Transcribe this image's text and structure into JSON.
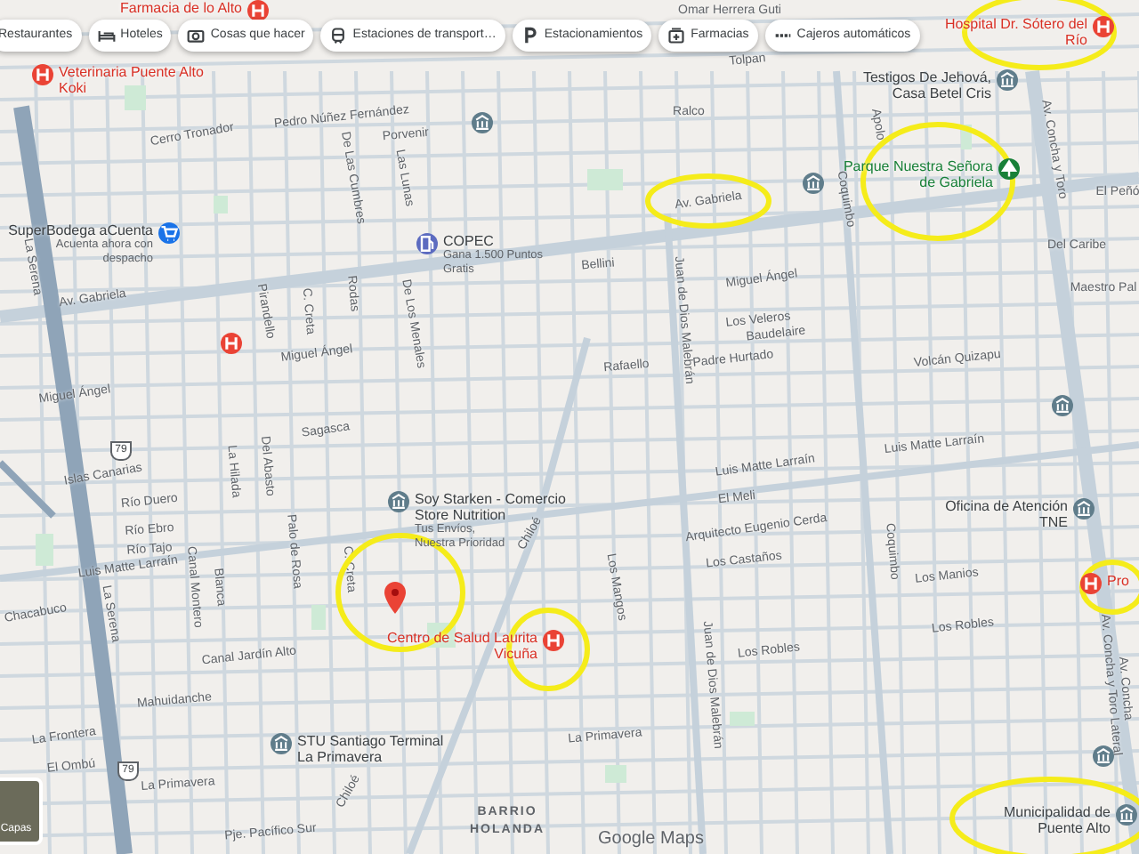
{
  "chips": [
    {
      "label": "Restaurantes"
    },
    {
      "label": "Hoteles"
    },
    {
      "label": "Cosas que hacer"
    },
    {
      "label": "Estaciones de transport…"
    },
    {
      "label": "Estacionamientos"
    },
    {
      "label": "Farmacias"
    },
    {
      "label": "Cajeros automáticos"
    }
  ],
  "pois": [
    {
      "name": "Farmacia de lo Alto",
      "kind": "health",
      "color": "#ea4335"
    },
    {
      "name": "Veterinaria Puente Alto Koki",
      "kind": "health",
      "color": "#ea4335"
    },
    {
      "name": "SuperBodega aCuenta",
      "subtitle": "Acuenta ahora con despacho",
      "kind": "shop",
      "color": "#1a73e8"
    },
    {
      "name": "COPEC",
      "subtitle": "Gana 1.500 Puntos Gratis",
      "kind": "fuel",
      "color": "#5c6bc0"
    },
    {
      "name": "Soy Starken - Comercio Store Nutrition",
      "subtitle": "Tus Envíos, Nuestra Prioridad",
      "kind": "service",
      "color": "#607d8b"
    },
    {
      "name": "Centro de Salud Laurita Vicuña",
      "kind": "health",
      "color": "#ea4335"
    },
    {
      "name": "STU Santiago Terminal La Primavera",
      "kind": "service",
      "color": "#607d8b"
    },
    {
      "name": "Hospital Dr. Sótero del Río",
      "kind": "health",
      "color": "#ea4335"
    },
    {
      "name": "Testigos De Jehová, Casa Betel Cris",
      "kind": "service",
      "color": "#607d8b"
    },
    {
      "name": "Parque Nuestra Señora de Gabriela",
      "kind": "park",
      "color": "#188038"
    },
    {
      "name": "Oficina de Atención TNE",
      "kind": "service",
      "color": "#607d8b"
    },
    {
      "name": "Pro",
      "kind": "health",
      "color": "#ea4335"
    },
    {
      "name": "Municipalidad de Puente Alto",
      "kind": "service",
      "color": "#607d8b"
    }
  ],
  "markers": [
    {
      "kind": "health",
      "color": "#ea4335"
    },
    {
      "kind": "service",
      "color": "#607d8b"
    },
    {
      "kind": "service",
      "color": "#607d8b"
    },
    {
      "kind": "service",
      "color": "#607d8b"
    },
    {
      "kind": "service",
      "color": "#607d8b"
    }
  ],
  "streets": [
    "Tolpan",
    "Omar Herrera Guti",
    "Cerro Tronador",
    "Pedro Núñez Fernández",
    "Porvenir",
    "De Las Cumbres",
    "Las Lunas",
    "Av. Gabriela",
    "La Serena",
    "Miguel Ángel",
    "Miguel Ángel",
    "Pirandello",
    "C. Creta",
    "Rodas",
    "De Los Menales",
    "Sagasca",
    "Islas Canarias",
    "Río Duero",
    "Río Ebro",
    "Río Tajo",
    "Luis Matte Larraín",
    "La Hilada",
    "Del Abasto",
    "Canal Montero",
    "Blanca",
    "Palo de Rosa",
    "C. Creta",
    "Chiloé",
    "Chacabuco",
    "La Serena",
    "Canal Jardín Alto",
    "Mahuidanche",
    "La Frontera",
    "El Ombú",
    "La Primavera",
    "Pje. Pacífico Sur",
    "Chiloé",
    "Ralco",
    "Apolo",
    "Av. Gabriela",
    "Coquimbo",
    "Av. Concha y Toro",
    "El Peñó",
    "Del Caribe",
    "Maestro Pal",
    "Bellini",
    "Miguel Ángel",
    "Juan de Dios Malebrán",
    "Los Veleros",
    "Baudelaire",
    "Padre Hurtado",
    "Volcán Quizapu",
    "Rafaello",
    "Luis Matte Larraín",
    "Luis Matte Larraín",
    "El Meli",
    "Arquitecto Eugenio Cerda",
    "Los Castaños",
    "Los Mangos",
    "Los Manios",
    "Los Robles",
    "Los Robles",
    "Juan de Dios Malebrán",
    "Coquimbo",
    "La Primavera",
    "Av. Concha y Toro Lateral",
    "Av. Concha"
  ],
  "route_shields": [
    "79",
    "79"
  ],
  "areas": [
    "BARRIO HOLANDA"
  ],
  "layers_button": {
    "label": "Capas"
  },
  "logo": "Google Maps"
}
